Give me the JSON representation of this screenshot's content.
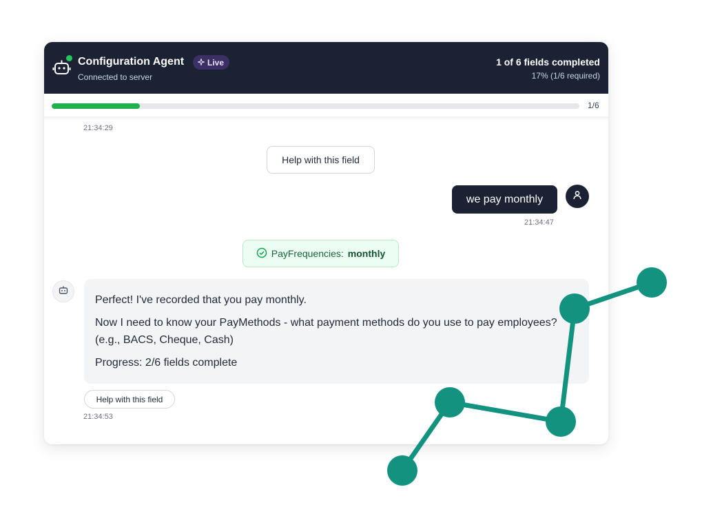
{
  "header": {
    "title": "Configuration Agent",
    "live_badge": "Live",
    "subtitle": "Connected to server",
    "fields_status": "1 of 6 fields completed",
    "fields_percent": "17% (1/6 required)"
  },
  "progress": {
    "fraction": 0.167,
    "count_label": "1/6",
    "fill_color": "#22b04b"
  },
  "messages": {
    "timestamp_1": "21:34:29",
    "help_center_label": "Help with this field",
    "user_message": "we pay monthly",
    "timestamp_user": "21:34:47",
    "field_chip_label": "PayFrequencies:",
    "field_chip_value": "monthly",
    "bot_line_1": "Perfect! I've recorded that you pay monthly.",
    "bot_line_2": "Now I need to know your PayMethods - what payment methods do you use to pay employees? (e.g., BACS, Cheque, Cash)",
    "bot_line_3": "Progress: 2/6 fields complete",
    "help_small_label": "Help with this field",
    "timestamp_bot": "21:34:53"
  },
  "icons": {
    "header_icon": "robot-icon",
    "live_icon": "sparkle-icon",
    "user_icon": "user-icon",
    "chip_icon": "check-circle-icon",
    "bot_icon": "robot-icon"
  },
  "colors": {
    "header_bg": "#1b2234",
    "accent_green": "#22b04b",
    "graph_teal": "#13937f"
  }
}
